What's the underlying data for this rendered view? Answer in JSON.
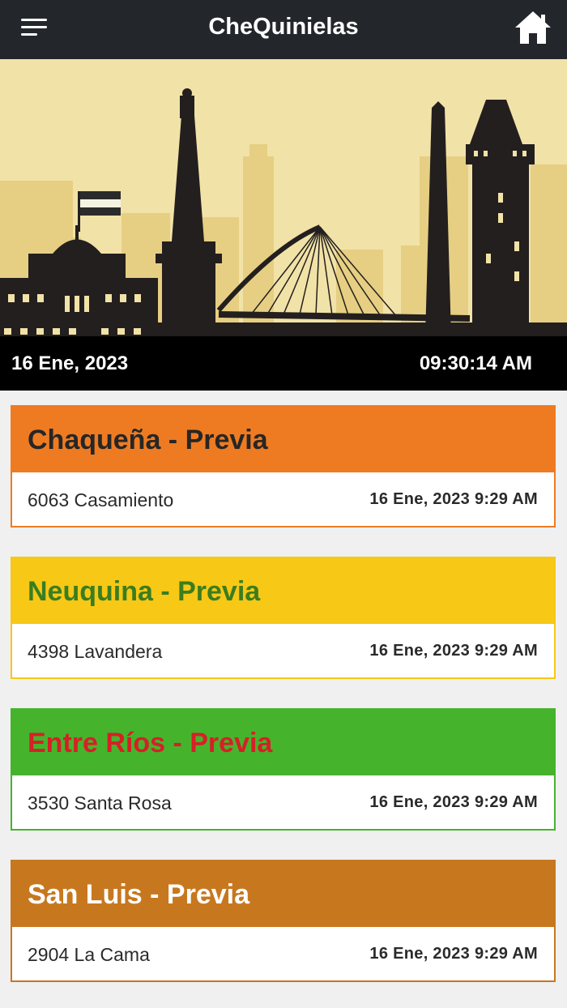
{
  "header": {
    "title": "CheQuinielas",
    "menu_icon": "hamburger-menu-icon",
    "home_icon": "home-icon"
  },
  "banner": {
    "image": "buenos-aires-skyline-illustration"
  },
  "datebar": {
    "date": "16 Ene, 2023",
    "time": "09:30:14 AM"
  },
  "cards": [
    {
      "title": "Chaqueña - Previa",
      "result": "6063 Casamiento",
      "stamp": "16 Ene, 2023 9:29 AM",
      "header_color": "#ee7b22",
      "title_color": "#262626",
      "border_color": "#ee7b22"
    },
    {
      "title": "Neuquina - Previa",
      "result": "4398 Lavandera",
      "stamp": "16 Ene, 2023 9:29 AM",
      "header_color": "#f7c815",
      "title_color": "#3b7d1f",
      "border_color": "#f7c815"
    },
    {
      "title": "Entre Ríos - Previa",
      "result": "3530 Santa Rosa",
      "stamp": "16 Ene, 2023 9:29 AM",
      "header_color": "#46b32d",
      "title_color": "#d71f27",
      "border_color": "#46b32d"
    },
    {
      "title": "San Luis - Previa",
      "result": "2904 La Cama",
      "stamp": "16 Ene, 2023 9:29 AM",
      "header_color": "#c7781f",
      "title_color": "#ffffff",
      "border_color": "#c7781f"
    }
  ]
}
